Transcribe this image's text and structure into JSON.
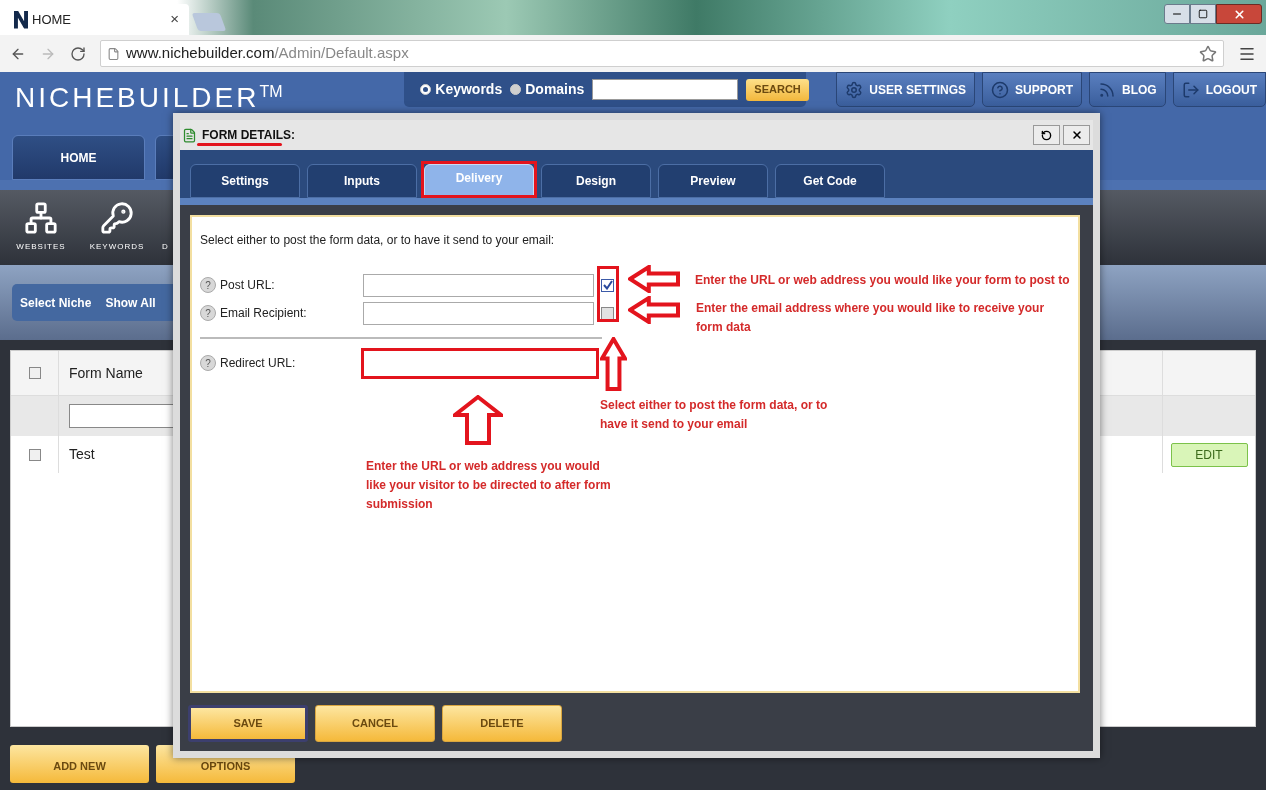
{
  "browser": {
    "tab_title": "HOME",
    "tab_close": "×",
    "url_host": "www.nichebuilder.com",
    "url_path": "/Admin/Default.aspx"
  },
  "header": {
    "logo": "NICHEBUILDER",
    "logo_mark": "TM",
    "search": {
      "options": [
        {
          "label": "Keywords",
          "selected": true
        },
        {
          "label": "Domains",
          "selected": false
        }
      ],
      "button": "SEARCH"
    },
    "nav": [
      {
        "label": "USER SETTINGS",
        "kind": "gear"
      },
      {
        "label": "SUPPORT",
        "kind": "help"
      },
      {
        "label": "BLOG",
        "kind": "rss"
      },
      {
        "label": "LOGOUT",
        "kind": "logout"
      }
    ]
  },
  "main_tabs": [
    {
      "label": "HOME"
    }
  ],
  "toolbar": [
    {
      "label": "WEBSITES",
      "kind": "sitemap"
    },
    {
      "label": "KEYWORDS",
      "kind": "key"
    },
    {
      "label": "D",
      "kind": "text"
    }
  ],
  "niche_bar": [
    "Select Niche",
    "Show All"
  ],
  "table": {
    "header_checked": false,
    "columns": [
      "Form Name"
    ],
    "rows": [
      {
        "checked": false,
        "name": "Test",
        "action": "EDIT"
      }
    ]
  },
  "bottom_buttons": [
    "ADD NEW",
    "OPTIONS"
  ],
  "modal": {
    "title": "FORM DETAILS:",
    "tabs": [
      {
        "label": "Settings",
        "selected": false
      },
      {
        "label": "Inputs",
        "selected": false
      },
      {
        "label": "Delivery",
        "selected": true
      },
      {
        "label": "Design",
        "selected": false
      },
      {
        "label": "Preview",
        "selected": false
      },
      {
        "label": "Get Code",
        "selected": false
      }
    ],
    "instruction": "Select either to post the form data, or to have it send to your email:",
    "fields": [
      {
        "help": "?",
        "label": "Post URL:",
        "kind": "checkbox",
        "checked": true
      },
      {
        "help": "?",
        "label": "Email Recipient:",
        "kind": "checkbox",
        "checked": false
      },
      {
        "help": "?",
        "label": "Redirect URL:",
        "kind": "plain"
      }
    ],
    "annotations": [
      "Enter the URL or web address you would like your form to post to",
      "Enter the email address where you would like to receive your form data",
      "Select either to post the form data, or to have it send to your email",
      "Enter the URL or web address you would like your visitor to be directed to after form submission"
    ],
    "buttons": [
      {
        "label": "SAVE",
        "focused": true
      },
      {
        "label": "CANCEL",
        "focused": false
      },
      {
        "label": "DELETE",
        "focused": false
      }
    ]
  }
}
